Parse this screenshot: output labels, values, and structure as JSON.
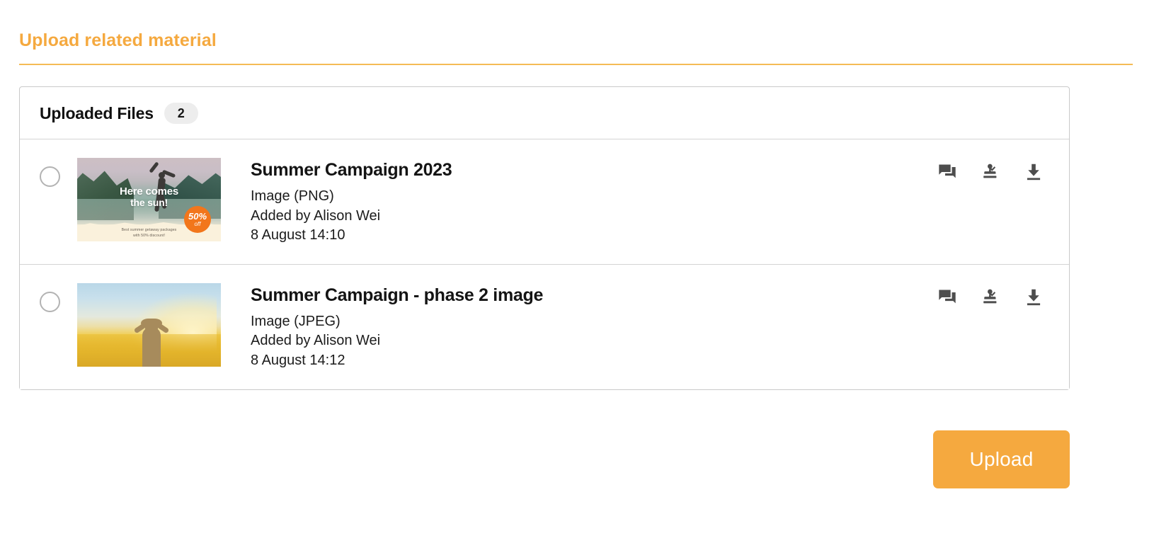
{
  "section": {
    "title": "Upload related material",
    "accent_color": "#F5A93F",
    "rule_color": "#F5BB55"
  },
  "files_card": {
    "header_title": "Uploaded Files",
    "count_badge": "2",
    "rows": [
      {
        "title": "Summer Campaign 2023",
        "type_line": "Image (PNG)",
        "added_by_line": "Added by Alison Wei",
        "timestamp_line": "8 August 14:10",
        "selected": false,
        "thumbnail": {
          "kind": "sun-poster",
          "headline_line1": "Here comes",
          "headline_line2": "the sun!",
          "badge_value": "50%",
          "badge_label": "off",
          "badge_color": "#F2761B",
          "caption_line1": "Best summer getaway packages",
          "caption_line2": "with 50% discount!"
        },
        "actions": [
          {
            "name": "comment-icon",
            "label": "Comment"
          },
          {
            "name": "approve-stamp-icon",
            "label": "Approve"
          },
          {
            "name": "download-icon",
            "label": "Download"
          }
        ]
      },
      {
        "title": "Summer Campaign - phase 2 image",
        "type_line": "Image (JPEG)",
        "added_by_line": "Added by Alison Wei",
        "timestamp_line": "8 August 14:12",
        "selected": false,
        "thumbnail": {
          "kind": "field-sunset"
        },
        "actions": [
          {
            "name": "comment-icon",
            "label": "Comment"
          },
          {
            "name": "approve-stamp-icon",
            "label": "Approve"
          },
          {
            "name": "download-icon",
            "label": "Download"
          }
        ]
      }
    ]
  },
  "footer": {
    "upload_label": "Upload",
    "upload_color": "#F5A93F"
  }
}
